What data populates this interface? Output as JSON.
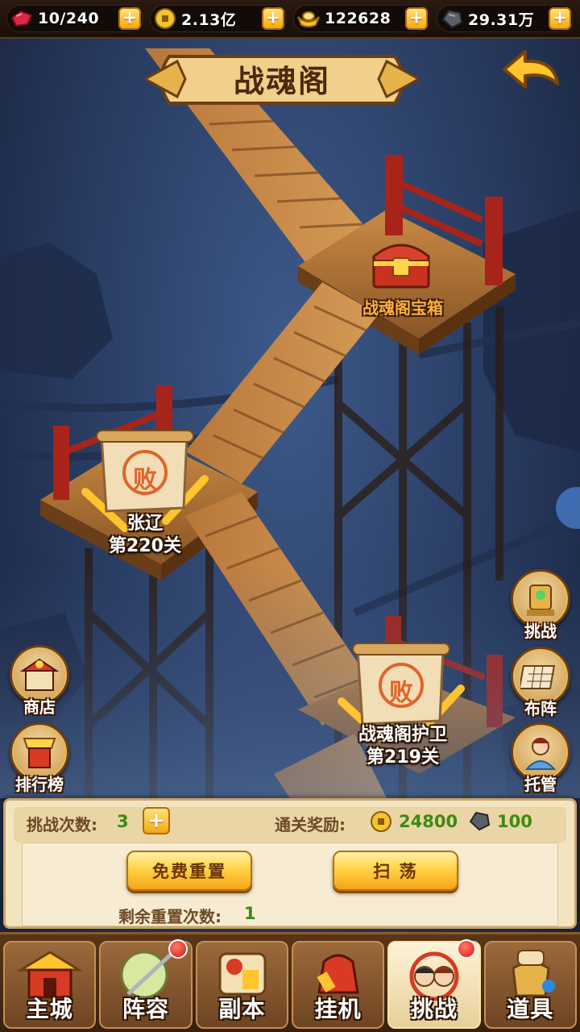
{
  "top_bar": {
    "stamina": "10/240",
    "copper": "2.13亿",
    "gold": "122628",
    "iron": "29.31万"
  },
  "header": {
    "title": "战魂阁"
  },
  "map": {
    "chest_label": "战魂阁宝箱",
    "stage_upper": {
      "name": "张辽",
      "level": "第220关",
      "seal": "败"
    },
    "stage_lower": {
      "name": "战魂阁护卫",
      "level": "第219关",
      "seal": "败"
    }
  },
  "side_left": [
    {
      "label": "商店",
      "icon": "shop-icon"
    },
    {
      "label": "排行榜",
      "icon": "ranking-icon"
    }
  ],
  "side_right": [
    {
      "label": "挑战",
      "icon": "challenge-icon"
    },
    {
      "label": "布阵",
      "icon": "formation-icon"
    },
    {
      "label": "托管",
      "icon": "auto-icon"
    }
  ],
  "panel": {
    "attempts_label": "挑战次数:",
    "attempts_value": "3",
    "reward_label": "通关奖励:",
    "reward_copper": "24800",
    "reward_iron": "100",
    "reset_button": "免费重置",
    "sweep_button": "扫 荡",
    "resets_left_label": "剩余重置次数:",
    "resets_left_value": "1"
  },
  "nav": [
    {
      "label": "主城",
      "icon": "city-icon",
      "badge": false
    },
    {
      "label": "阵容",
      "icon": "lineup-icon",
      "badge": true
    },
    {
      "label": "副本",
      "icon": "dungeon-icon",
      "badge": false
    },
    {
      "label": "挂机",
      "icon": "idle-icon",
      "badge": false
    },
    {
      "label": "挑战",
      "icon": "challenge-nav-icon",
      "badge": true,
      "active": true
    },
    {
      "label": "道具",
      "icon": "items-icon",
      "badge": false
    }
  ],
  "colors": {
    "accent_gold": "#f4a417",
    "reward_green": "#3d8a12",
    "panel_bg": "#f3e4c0",
    "chest_label": "#ffb23a"
  }
}
